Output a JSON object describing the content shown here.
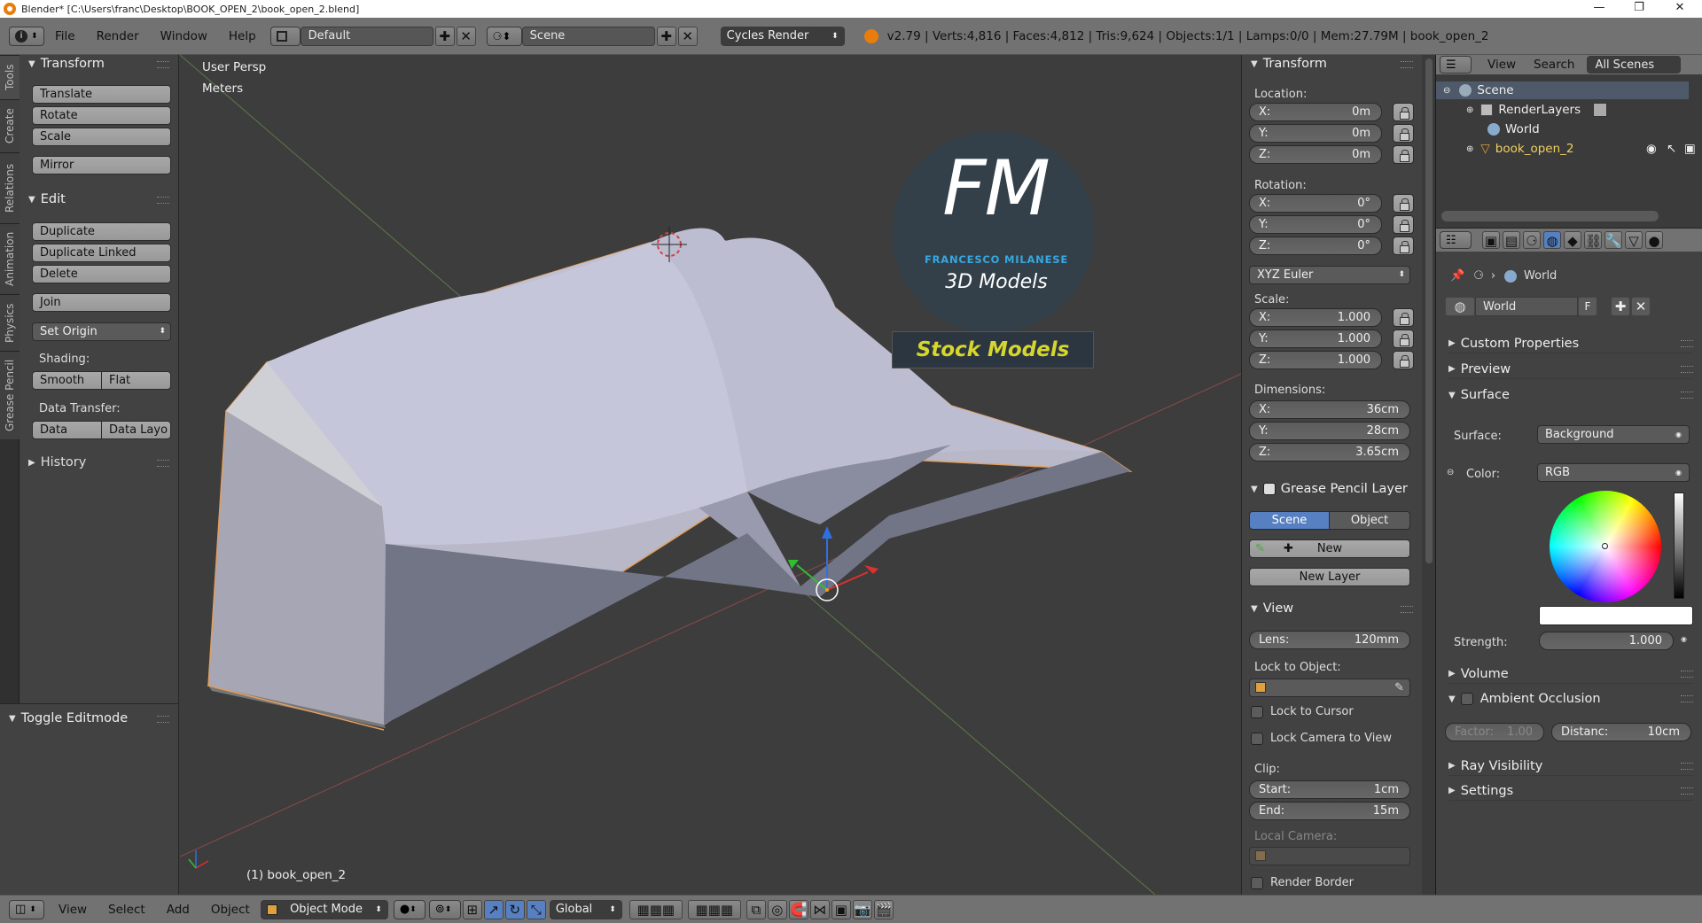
{
  "titlebar": {
    "title": "Blender* [C:\\Users\\franc\\Desktop\\BOOK_OPEN_2\\book_open_2.blend]",
    "min": "—",
    "max": "❐",
    "close": "✕"
  },
  "infobar": {
    "menus": [
      "File",
      "Render",
      "Window",
      "Help"
    ],
    "screen_layout": "Default",
    "scene": "Scene",
    "engine": "Cycles Render",
    "stats": "v2.79 | Verts:4,816 | Faces:4,812 | Tris:9,624 | Objects:1/1 | Lamps:0/0 | Mem:27.79M | book_open_2"
  },
  "tabs": [
    "Tools",
    "Create",
    "Relations",
    "Animation",
    "Physics",
    "Grease Pencil"
  ],
  "toolshelf": {
    "transform_header": "Transform",
    "translate": "Translate",
    "rotate": "Rotate",
    "scale": "Scale",
    "mirror": "Mirror",
    "edit_header": "Edit",
    "duplicate": "Duplicate",
    "duplicate_linked": "Duplicate Linked",
    "delete": "Delete",
    "join": "Join",
    "set_origin": "Set Origin",
    "shading_label": "Shading:",
    "smooth": "Smooth",
    "flat": "Flat",
    "data_transfer_label": "Data Transfer:",
    "data": "Data",
    "data_layo": "Data Layo",
    "history_header": "History",
    "toggle_editmode": "Toggle Editmode"
  },
  "viewport": {
    "view_name": "User Persp",
    "units": "Meters",
    "object_label": "(1) book_open_2",
    "watermark": {
      "initials": "FM",
      "name": "FRANCESCO MILANESE",
      "subtitle": "3D Models",
      "banner": "Stock Models"
    }
  },
  "npanel": {
    "transform_header": "Transform",
    "location_label": "Location:",
    "location": [
      {
        "k": "X:",
        "v": "0m"
      },
      {
        "k": "Y:",
        "v": "0m"
      },
      {
        "k": "Z:",
        "v": "0m"
      }
    ],
    "rotation_label": "Rotation:",
    "rotation": [
      {
        "k": "X:",
        "v": "0°"
      },
      {
        "k": "Y:",
        "v": "0°"
      },
      {
        "k": "Z:",
        "v": "0°"
      }
    ],
    "rotation_mode": "XYZ Euler",
    "scale_label": "Scale:",
    "scale": [
      {
        "k": "X:",
        "v": "1.000"
      },
      {
        "k": "Y:",
        "v": "1.000"
      },
      {
        "k": "Z:",
        "v": "1.000"
      }
    ],
    "dimensions_label": "Dimensions:",
    "dimensions": [
      {
        "k": "X:",
        "v": "36cm"
      },
      {
        "k": "Y:",
        "v": "28cm"
      },
      {
        "k": "Z:",
        "v": "3.65cm"
      }
    ],
    "gp_header": "Grease Pencil Layer",
    "gp_scene": "Scene",
    "gp_object": "Object",
    "gp_new": "New",
    "gp_new_layer": "New Layer",
    "view_header": "View",
    "lens_label": "Lens:",
    "lens_value": "120mm",
    "lock_to_object": "Lock to Object:",
    "lock_to_cursor": "Lock to Cursor",
    "lock_camera": "Lock Camera to View",
    "clip_label": "Clip:",
    "clip_start_label": "Start:",
    "clip_start": "1cm",
    "clip_end_label": "End:",
    "clip_end": "15m",
    "local_camera": "Local Camera:",
    "render_border": "Render Border"
  },
  "outliner": {
    "view": "View",
    "search": "Search",
    "filter": "All Scenes",
    "items": [
      "Scene",
      "RenderLayers",
      "World",
      "book_open_2"
    ]
  },
  "props": {
    "breadcrumb": "World",
    "world_name": "World",
    "fake_user": "F",
    "custom_properties": "Custom Properties",
    "preview": "Preview",
    "surface_header": "Surface",
    "surface_label": "Surface:",
    "surface_value": "Background",
    "color_label": "Color:",
    "color_value": "RGB",
    "strength_label": "Strength:",
    "strength_value": "1.000",
    "volume": "Volume",
    "ambient_occlusion": "Ambient Occlusion",
    "factor_label": "Factor:",
    "factor_value": "1.00",
    "distance_label": "Distanc:",
    "distance_value": "10cm",
    "ray_visibility": "Ray Visibility",
    "settings": "Settings"
  },
  "footer": {
    "menus": [
      "View",
      "Select",
      "Add",
      "Object"
    ],
    "mode": "Object Mode",
    "orientation": "Global"
  },
  "colors": {
    "accent": "#5680c2",
    "header": "#727272",
    "panel": "#424242",
    "viewport": "#3d3d3d",
    "selection_outline": "#f0a040"
  }
}
